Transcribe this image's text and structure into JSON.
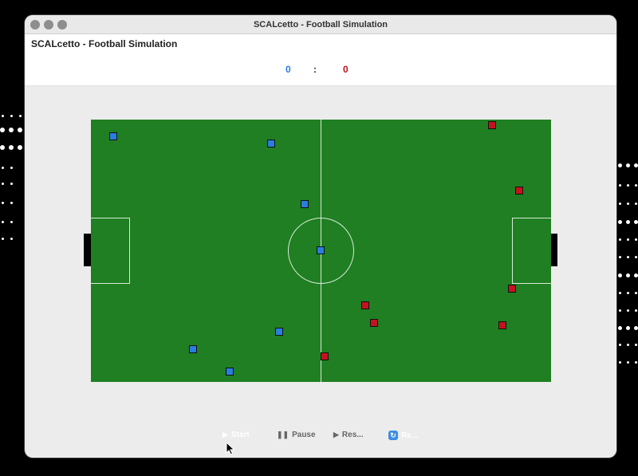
{
  "window": {
    "title": "SCALcetto - Football Simulation"
  },
  "app": {
    "title": "SCALcetto - Football Simulation"
  },
  "score": {
    "blue": "0",
    "separator": ":",
    "red": "0"
  },
  "colors": {
    "team_blue": "#2a7de1",
    "team_red": "#c4121e",
    "pitch": "#1f7f22"
  },
  "controls": {
    "start_label": "Start",
    "start_icon": "play-icon",
    "pause_label": "Pause",
    "pause_icon": "pause-icon",
    "resume_label": "Res...",
    "resume_icon": "play-icon",
    "reset_label": "Re...",
    "reset_icon": "refresh-icon"
  }
}
